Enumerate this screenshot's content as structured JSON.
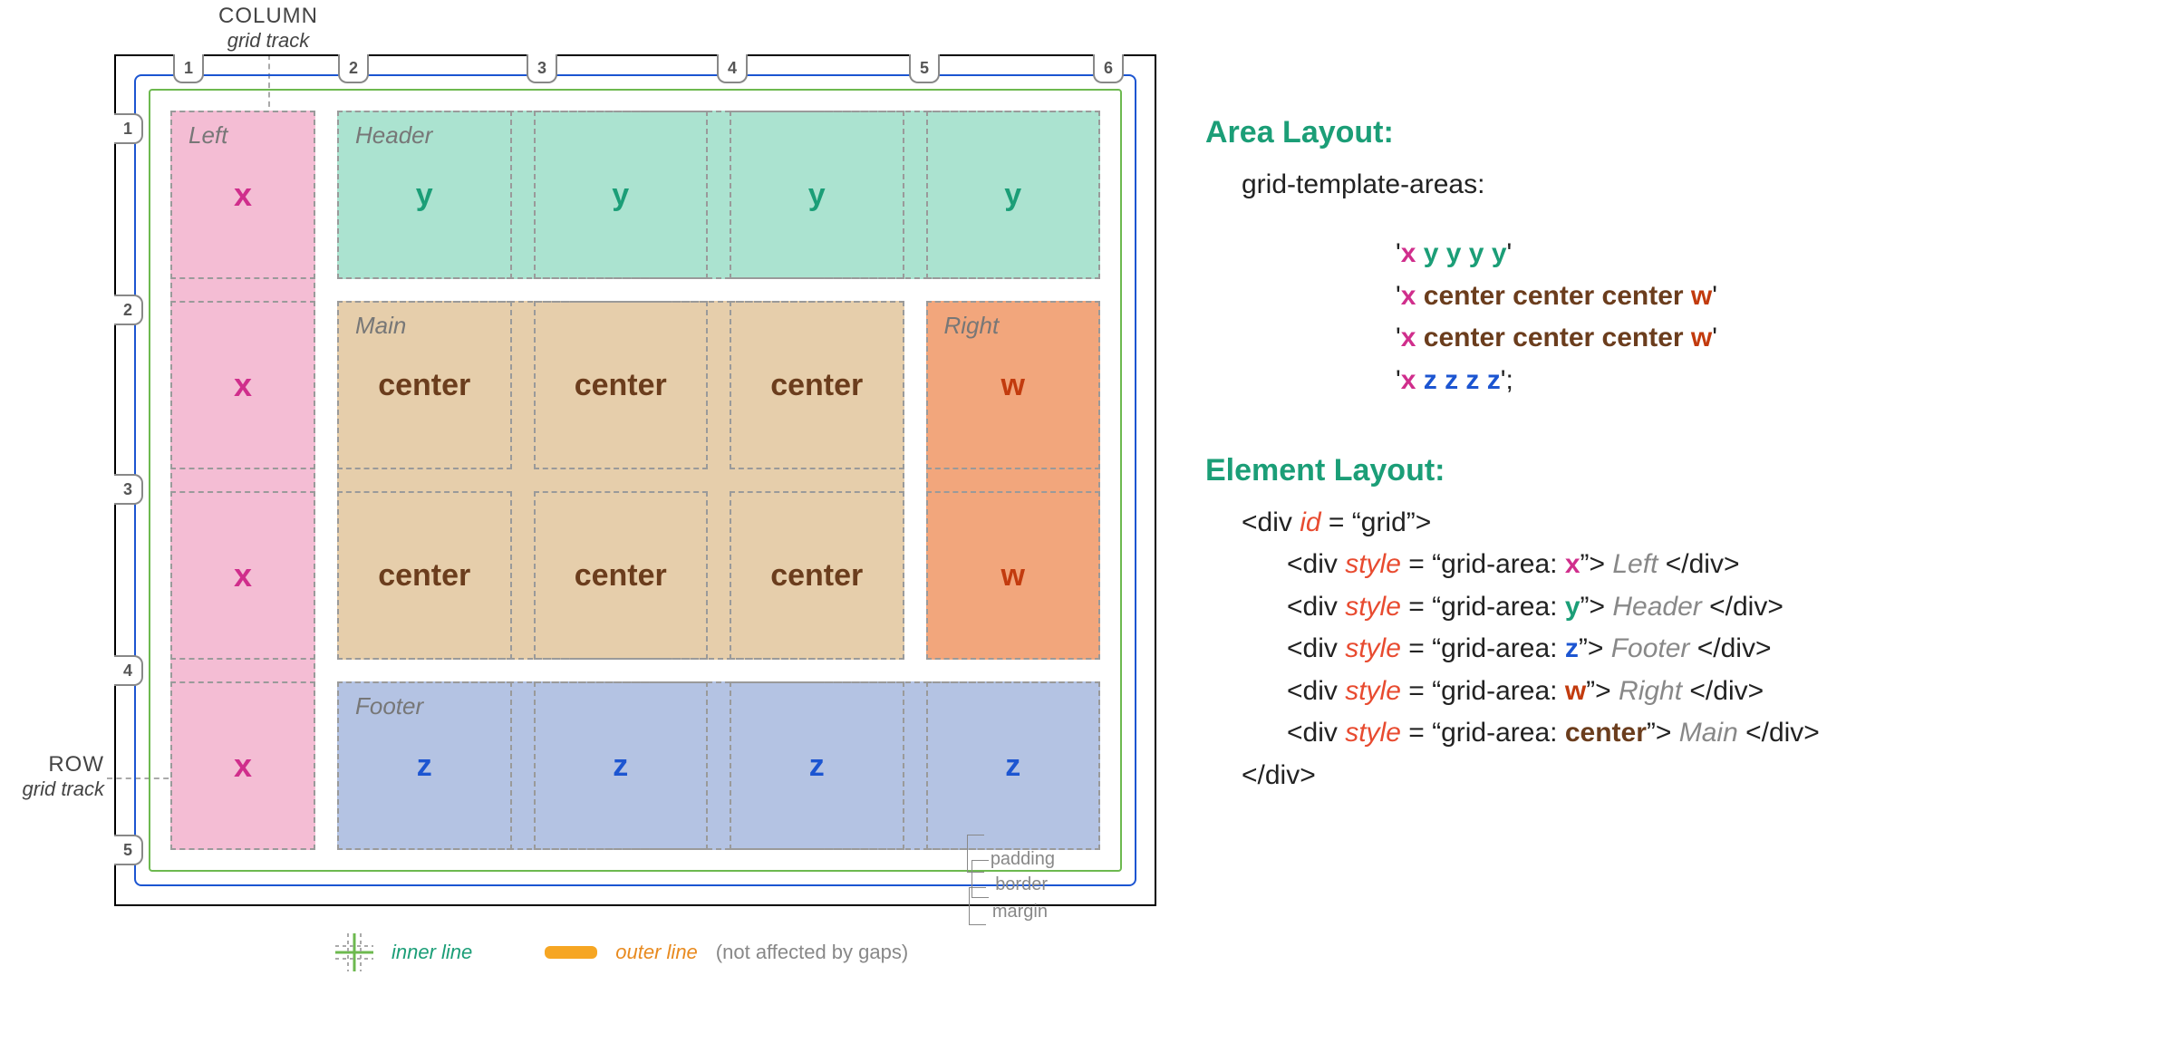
{
  "labels": {
    "column_title": "COLUMN",
    "column_sub": "grid track",
    "row_title": "ROW",
    "row_sub": "grid track"
  },
  "area_names": {
    "left": "Left",
    "header": "Header",
    "main": "Main",
    "right": "Right",
    "footer": "Footer"
  },
  "col_badges": [
    "1",
    "2",
    "3",
    "4",
    "5",
    "6"
  ],
  "row_badges": [
    "1",
    "2",
    "3",
    "4",
    "5"
  ],
  "cells": [
    [
      "x",
      "y",
      "y",
      "y",
      "y"
    ],
    [
      "x",
      "center",
      "center",
      "center",
      "w"
    ],
    [
      "x",
      "center",
      "center",
      "center",
      "w"
    ],
    [
      "x",
      "z",
      "z",
      "z",
      "z"
    ]
  ],
  "box_labels": {
    "padding": "padding",
    "border": "border",
    "margin": "margin"
  },
  "legend": {
    "inner": "inner line",
    "outer": "outer line",
    "outer_note": "(not affected by gaps)"
  },
  "panel": {
    "area_heading": "Area Layout:",
    "area_prop": "grid-template-areas:",
    "template_rows": [
      [
        {
          "t": "'",
          "c": ""
        },
        {
          "t": "x",
          "c": "x"
        },
        {
          "t": " ",
          "c": ""
        },
        {
          "t": "y y y y",
          "c": "y"
        },
        {
          "t": "'",
          "c": ""
        }
      ],
      [
        {
          "t": "'",
          "c": ""
        },
        {
          "t": "x",
          "c": "x"
        },
        {
          "t": " center center center ",
          "c": "c"
        },
        {
          "t": "w",
          "c": "w"
        },
        {
          "t": "'",
          "c": ""
        }
      ],
      [
        {
          "t": "'",
          "c": ""
        },
        {
          "t": "x",
          "c": "x"
        },
        {
          "t": " center center center ",
          "c": "c"
        },
        {
          "t": "w",
          "c": "w"
        },
        {
          "t": "'",
          "c": ""
        }
      ],
      [
        {
          "t": "'",
          "c": ""
        },
        {
          "t": "x",
          "c": "x"
        },
        {
          "t": " ",
          "c": ""
        },
        {
          "t": "z z z z",
          "c": "z"
        },
        {
          "t": "';",
          "c": ""
        }
      ]
    ],
    "elem_heading": "Element Layout:",
    "code_lines": [
      {
        "indent": 0,
        "parts": [
          {
            "t": "<div "
          },
          {
            "t": "id",
            "c": "kw"
          },
          {
            "t": " = “grid”>"
          }
        ]
      },
      {
        "indent": 1,
        "parts": [
          {
            "t": "<div "
          },
          {
            "t": "style",
            "c": "kw"
          },
          {
            "t": " = “grid-area: "
          },
          {
            "t": "x",
            "c": "x"
          },
          {
            "t": "”> "
          },
          {
            "t": "Left",
            "c": "inner"
          },
          {
            "t": " </div>"
          }
        ]
      },
      {
        "indent": 1,
        "parts": [
          {
            "t": "<div "
          },
          {
            "t": "style",
            "c": "kw"
          },
          {
            "t": " = “grid-area: "
          },
          {
            "t": "y",
            "c": "y"
          },
          {
            "t": "”> "
          },
          {
            "t": "Header",
            "c": "inner"
          },
          {
            "t": " </div>"
          }
        ]
      },
      {
        "indent": 1,
        "parts": [
          {
            "t": "<div "
          },
          {
            "t": "style",
            "c": "kw"
          },
          {
            "t": " = “grid-area: "
          },
          {
            "t": "z",
            "c": "z"
          },
          {
            "t": "”> "
          },
          {
            "t": "Footer",
            "c": "inner"
          },
          {
            "t": " </div>"
          }
        ]
      },
      {
        "indent": 1,
        "parts": [
          {
            "t": "<div "
          },
          {
            "t": "style",
            "c": "kw"
          },
          {
            "t": " = “grid-area: "
          },
          {
            "t": "w",
            "c": "w"
          },
          {
            "t": "”> "
          },
          {
            "t": "Right",
            "c": "inner"
          },
          {
            "t": " </div>"
          }
        ]
      },
      {
        "indent": 1,
        "parts": [
          {
            "t": "<div "
          },
          {
            "t": "style",
            "c": "kw"
          },
          {
            "t": " = “grid-area: "
          },
          {
            "t": "center",
            "c": "c"
          },
          {
            "t": "”> "
          },
          {
            "t": "Main",
            "c": "inner"
          },
          {
            "t": " </div>"
          }
        ]
      },
      {
        "indent": 0,
        "parts": [
          {
            "t": "</div>"
          }
        ]
      }
    ]
  }
}
